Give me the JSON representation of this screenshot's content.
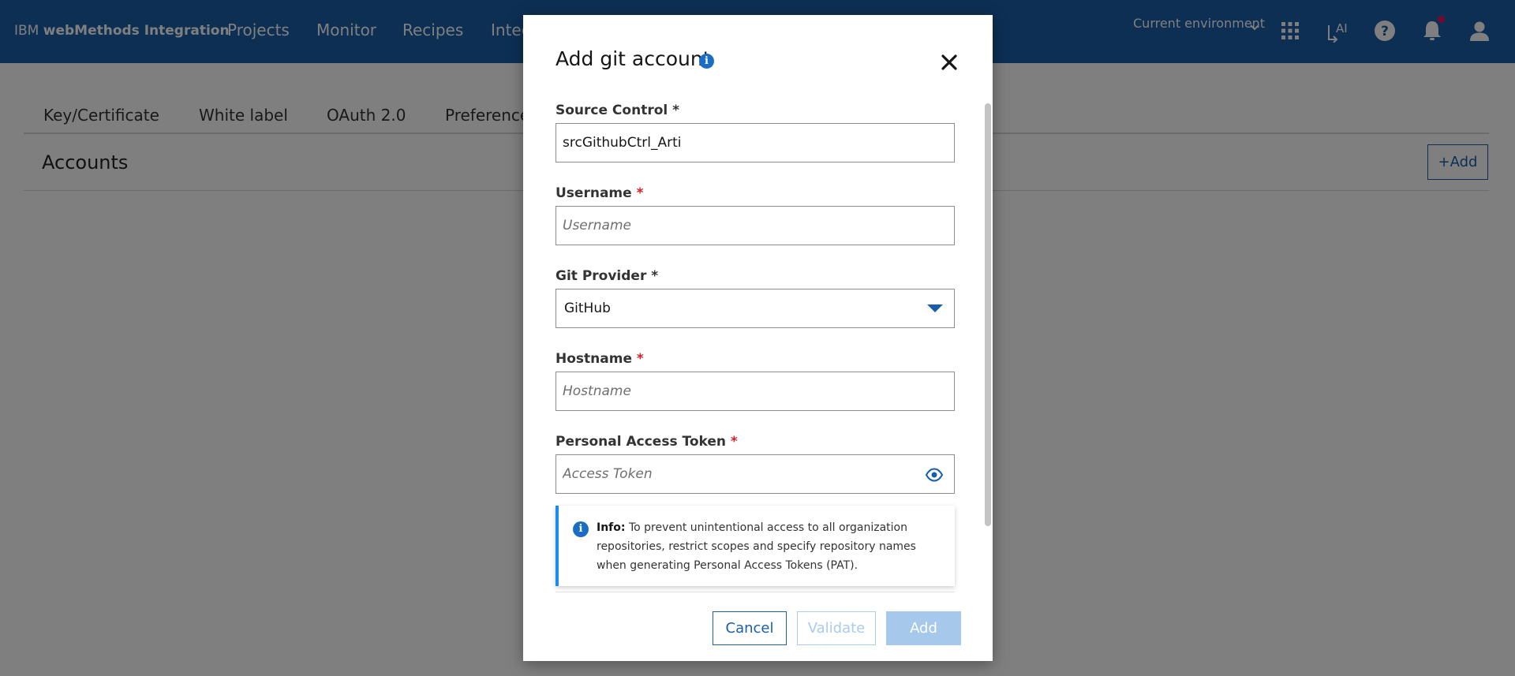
{
  "header": {
    "brand_prefix": "IBM",
    "brand_name": "webMethods Integration",
    "nav": [
      "Projects",
      "Monitor",
      "Recipes",
      "Integ"
    ],
    "environment": "Current environment",
    "icons": [
      "chevron-down-icon",
      "app-switcher-icon",
      "ai-icon",
      "help-icon",
      "notification-icon",
      "user-icon"
    ],
    "notification_dot_color": "#e8175d"
  },
  "page": {
    "tabs": [
      "Key/Certificate",
      "White label",
      "OAuth 2.0",
      "Preference"
    ],
    "accounts_title": "Accounts",
    "add_button": "+Add"
  },
  "modal": {
    "title": "Add git account",
    "info_icon": "i",
    "fields": {
      "source_control": {
        "label": "Source Control",
        "required": "*",
        "value": "srcGithubCtrl_Arti"
      },
      "username": {
        "label": "Username",
        "required": "*",
        "placeholder": "Username"
      },
      "git_provider": {
        "label": "Git Provider",
        "required": "*",
        "value": "GitHub"
      },
      "hostname": {
        "label": "Hostname",
        "required": "*",
        "placeholder": "Hostname"
      },
      "token": {
        "label": "Personal Access Token",
        "required": "*",
        "placeholder": "Access Token"
      }
    },
    "info": {
      "icon": "i",
      "label": "Info:",
      "text": "To prevent unintentional access to all organization repositories, restrict scopes and specify repository names when generating Personal Access Tokens (PAT)."
    },
    "buttons": {
      "cancel": "Cancel",
      "validate": "Validate",
      "add": "Add"
    }
  },
  "colors": {
    "header_bg": "#1a5ea8",
    "accent": "#1a5ea8",
    "required": "#da1e28",
    "info_border": "#1a8cf0",
    "disabled_button": "#a6c8eb"
  }
}
